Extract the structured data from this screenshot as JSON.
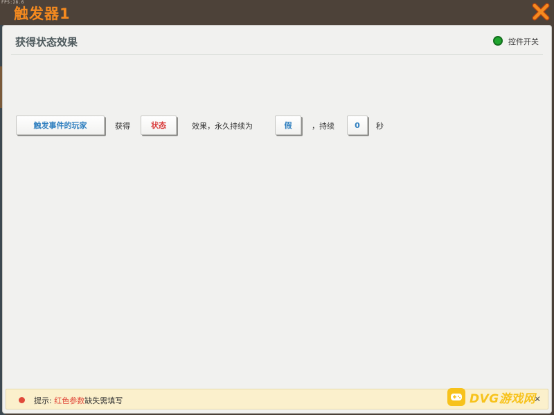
{
  "window": {
    "fps": "FPS:28.6",
    "title": "触发器1"
  },
  "panel": {
    "title": "获得状态效果",
    "switch_label": "控件开关",
    "switch_color": "#1fa52e"
  },
  "statement": {
    "player_button": "触发事件的玩家",
    "text_get": "获得",
    "status_button": "状态",
    "text_effect": "效果，永久持续为",
    "permanent_button": "假",
    "text_duration": "，持续",
    "duration_button": "0",
    "text_seconds": "秒"
  },
  "hint": {
    "prefix": "提示:",
    "highlight": "红色参数",
    "suffix": "缺失需填写",
    "highlight_color": "#e0493a"
  },
  "watermark": {
    "text": "DVG游戏网"
  },
  "icons": {
    "close": "close-icon",
    "switch": "status-dot-icon",
    "hint": "warning-dot-icon",
    "logo": "gamepad-icon"
  }
}
